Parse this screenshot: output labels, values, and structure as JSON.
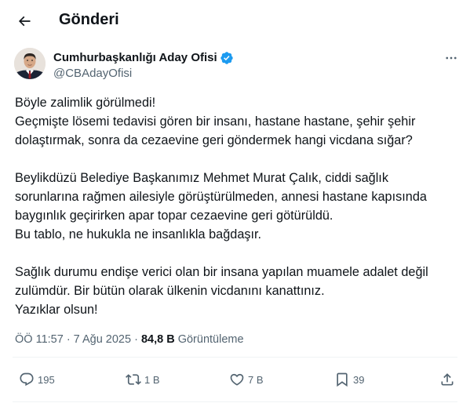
{
  "header": {
    "title": "Gönderi"
  },
  "author": {
    "display_name": "Cumhurbaşkanlığı Aday Ofisi",
    "handle": "@CBAdayOfisi",
    "verified": true
  },
  "tweet": {
    "lines": [
      "Böyle zalimlik görülmedi!",
      "Geçmişte lösemi tedavisi gören bir insanı, hastane hastane, şehir şehir",
      "dolaştırmak, sonra da cezaevine geri göndermek hangi vicdana sığar?",
      "",
      "Beylikdüzü Belediye Başkanımız Mehmet Murat Çalık, ciddi sağlık",
      "sorunlarına rağmen ailesiyle görüştürülmeden, annesi hastane kapısında",
      "baygınlık geçirirken apar topar cezaevine geri götürüldü.",
      "Bu tablo, ne hukukla ne insanlıkla bağdaşır.",
      "",
      "Sağlık durumu endişe verici olan bir insana yapılan muamele adalet değil",
      "zulümdür. Bir bütün olarak ülkenin vicdanını kanattınız.",
      "Yazıklar olsun!"
    ],
    "timestamp": "ÖÖ 11:57 · 7 Ağu 2025",
    "meta_separator": " · ",
    "views_count": "84,8 B",
    "views_label": "Görüntüleme"
  },
  "actions": {
    "replies": "195",
    "reposts": "1 B",
    "likes": "7 B",
    "bookmarks": "39"
  },
  "colors": {
    "text": "#0f1419",
    "secondary": "#536471",
    "verified": "#1d9bf0",
    "divider": "#eff3f4"
  }
}
